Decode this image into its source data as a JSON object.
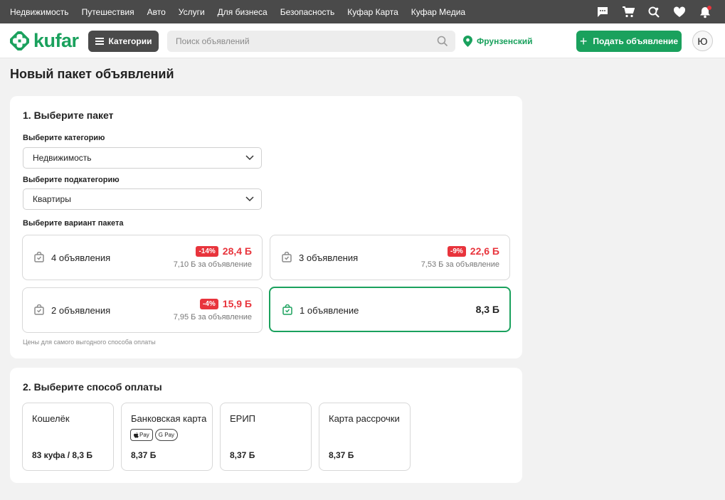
{
  "topnav": {
    "links": [
      "Недвижимость",
      "Путешествия",
      "Авто",
      "Услуги",
      "Для бизнеса",
      "Безопасность",
      "Куфар Карта",
      "Куфар Медиа"
    ]
  },
  "topicons": [
    "chat-icon",
    "cart-icon",
    "search-heart-icon",
    "heart-icon",
    "bell-icon"
  ],
  "header": {
    "logo_text": "kufar",
    "categories_label": "Категории",
    "search_placeholder": "Поиск объявлений",
    "location": "Фрунзенский",
    "post_label": "Подать объявление",
    "avatar_letter": "Ю"
  },
  "colors": {
    "brand": "#1aa15d",
    "discount": "#e8343c",
    "topbar": "#4a4a4a"
  },
  "page": {
    "title": "Новый пакет объявлений"
  },
  "step1": {
    "title": "1. Выберите пакет",
    "category_label": "Выберите категорию",
    "category_value": "Недвижимость",
    "subcategory_label": "Выберите подкатегорию",
    "subcategory_value": "Квартиры",
    "variant_label": "Выберите вариант пакета",
    "packages": [
      {
        "name": "4 объявления",
        "discount": "-14%",
        "price": "28,4 Б",
        "per": "7,10 Б за объявление",
        "selected": false
      },
      {
        "name": "3 объявления",
        "discount": "-9%",
        "price": "22,6 Б",
        "per": "7,53 Б за объявление",
        "selected": false
      },
      {
        "name": "2 объявления",
        "discount": "-4%",
        "price": "15,9 Б",
        "per": "7,95 Б за объявление",
        "selected": false
      },
      {
        "name": "1 объявление",
        "discount": "",
        "price": "8,3 Б",
        "per": "",
        "selected": true
      }
    ],
    "note": "Цены для самого выгодного способа оплаты"
  },
  "step2": {
    "title": "2. Выберите способ оплаты",
    "methods": [
      {
        "name": "Кошелёк",
        "price": "83 куфа / 8,3 Б"
      },
      {
        "name": "Банковская карта",
        "price": "8,37 Б",
        "badges": [
          "Pay",
          "G Pay"
        ]
      },
      {
        "name": "ЕРИП",
        "price": "8,37 Б"
      },
      {
        "name": "Карта рассрочки",
        "price": "8,37 Б"
      }
    ]
  }
}
